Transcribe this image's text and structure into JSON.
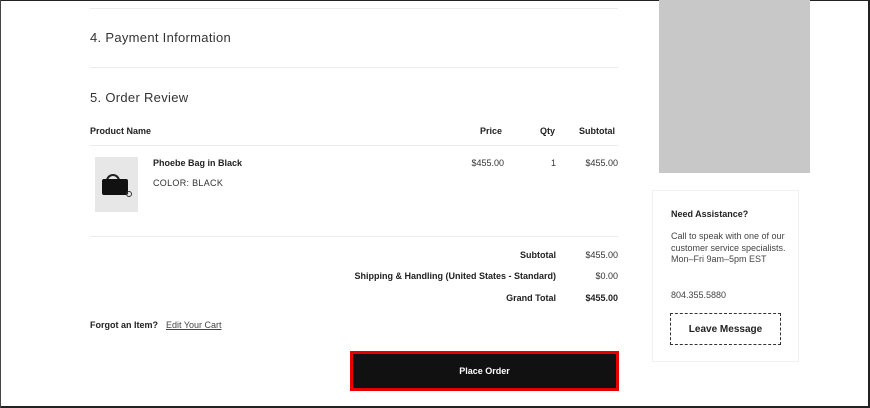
{
  "sections": {
    "payment_title": "4. Payment Information",
    "review_title": "5. Order Review"
  },
  "table": {
    "headers": {
      "product": "Product Name",
      "price": "Price",
      "qty": "Qty",
      "subtotal": "Subtotal"
    },
    "item": {
      "name": "Phoebe Bag in Black",
      "attribute": "COLOR: BLACK",
      "price": "$455.00",
      "qty": "1",
      "subtotal": "$455.00",
      "thumbnail_icon": "black-bag-thumbnail"
    }
  },
  "totals": {
    "subtotal_label": "Subtotal",
    "subtotal_value": "$455.00",
    "shipping_label": "Shipping & Handling (United States - Standard)",
    "shipping_value": "$0.00",
    "grand_label": "Grand Total",
    "grand_value": "$455.00"
  },
  "cart": {
    "forgot_text": "Forgot an Item?",
    "edit_link": "Edit Your Cart"
  },
  "actions": {
    "place_order": "Place Order"
  },
  "assistance": {
    "title": "Need Assistance?",
    "body": "Call to speak with one of our customer service specialists.",
    "hours": "Mon–Fri 9am–5pm EST",
    "phone": "804.355.5880",
    "leave_message": "Leave Message"
  },
  "colors": {
    "place_order_bg": "#111111",
    "place_order_highlight": "#e60000",
    "promo_placeholder": "#c8c8c8"
  }
}
